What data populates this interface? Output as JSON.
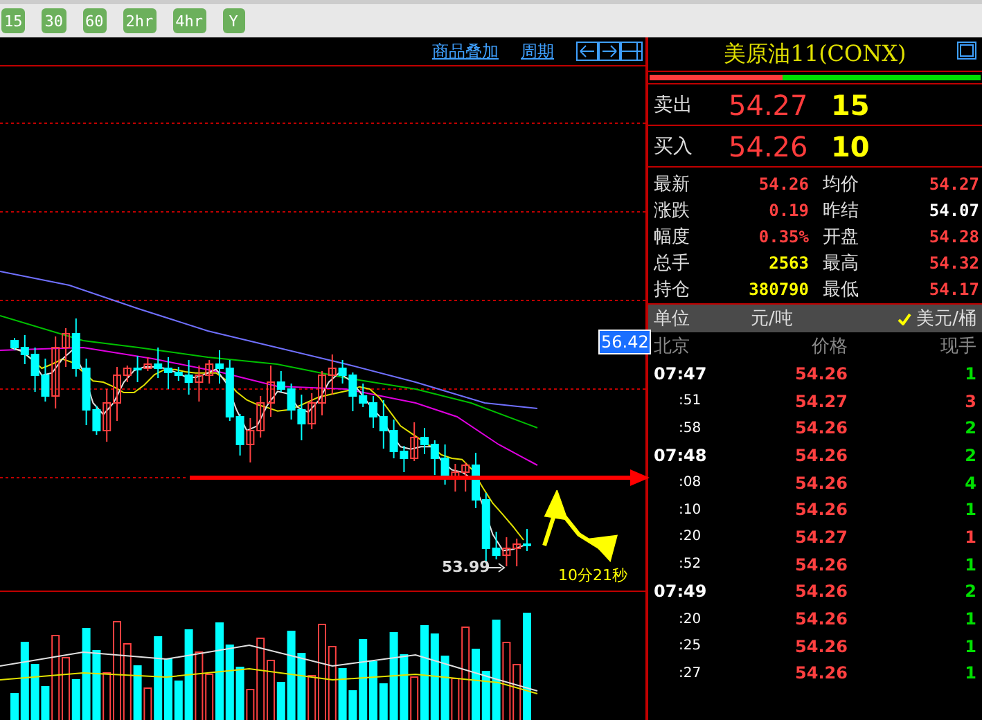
{
  "toolbar": {
    "buttons": [
      "15",
      "30",
      "60",
      "2hr",
      "4hr",
      "Y"
    ]
  },
  "chart": {
    "links": [
      "商品叠加",
      "周期"
    ],
    "price_tag": "56.42",
    "low_label": "53.99",
    "countdown": "10分21秒"
  },
  "quote": {
    "title": "美原油11(CONX)",
    "ratio": {
      "level": 0.4
    },
    "sell": {
      "label": "卖出",
      "price": "54.27",
      "volume": "15"
    },
    "buy": {
      "label": "买入",
      "price": "54.26",
      "volume": "10"
    },
    "stats": [
      {
        "label": "最新",
        "value": "54.26",
        "color": "#ff4040"
      },
      {
        "label": "均价",
        "value": "54.27",
        "color": "#ff4040"
      },
      {
        "label": "涨跌",
        "value": "0.19",
        "color": "#ff4040"
      },
      {
        "label": "昨结",
        "value": "54.07",
        "color": "#ffffff"
      },
      {
        "label": "幅度",
        "value": "0.35%",
        "color": "#ff4040"
      },
      {
        "label": "开盘",
        "value": "54.28",
        "color": "#ff4040"
      },
      {
        "label": "总手",
        "value": "2563",
        "color": "#ffff00"
      },
      {
        "label": "最高",
        "value": "54.32",
        "color": "#ff4040"
      },
      {
        "label": "持仓",
        "value": "380790",
        "color": "#ffff00"
      },
      {
        "label": "最低",
        "value": "54.17",
        "color": "#ff4040"
      }
    ]
  },
  "units": {
    "label": "单位",
    "options": [
      {
        "label": "元/吨",
        "selected": false
      },
      {
        "label": "美元/桶",
        "selected": true
      }
    ]
  },
  "trades": {
    "columns": [
      "北京",
      "价格",
      "现手"
    ],
    "rows": [
      {
        "time": "07:47",
        "kind": "minute",
        "price": "54.26",
        "volume": "1",
        "color": "#00e000"
      },
      {
        "time": ":51",
        "kind": "second",
        "price": "54.27",
        "volume": "3",
        "color": "#ff4040"
      },
      {
        "time": ":58",
        "kind": "second",
        "price": "54.26",
        "volume": "2",
        "color": "#00e000"
      },
      {
        "time": "07:48",
        "kind": "minute",
        "price": "54.26",
        "volume": "2",
        "color": "#00e000"
      },
      {
        "time": ":08",
        "kind": "second",
        "price": "54.26",
        "volume": "4",
        "color": "#00e000"
      },
      {
        "time": ":10",
        "kind": "second",
        "price": "54.26",
        "volume": "1",
        "color": "#00e000"
      },
      {
        "time": ":20",
        "kind": "second",
        "price": "54.27",
        "volume": "1",
        "color": "#ff4040"
      },
      {
        "time": ":52",
        "kind": "second",
        "price": "54.26",
        "volume": "1",
        "color": "#00e000"
      },
      {
        "time": "07:49",
        "kind": "minute",
        "price": "54.26",
        "volume": "2",
        "color": "#00e000"
      },
      {
        "time": ":20",
        "kind": "second",
        "price": "54.26",
        "volume": "1",
        "color": "#00e000"
      },
      {
        "time": ":25",
        "kind": "second",
        "price": "54.26",
        "volume": "1",
        "color": "#00e000"
      },
      {
        "time": ":27",
        "kind": "second",
        "price": "54.26",
        "volume": "1",
        "color": "#00e000"
      }
    ]
  }
}
